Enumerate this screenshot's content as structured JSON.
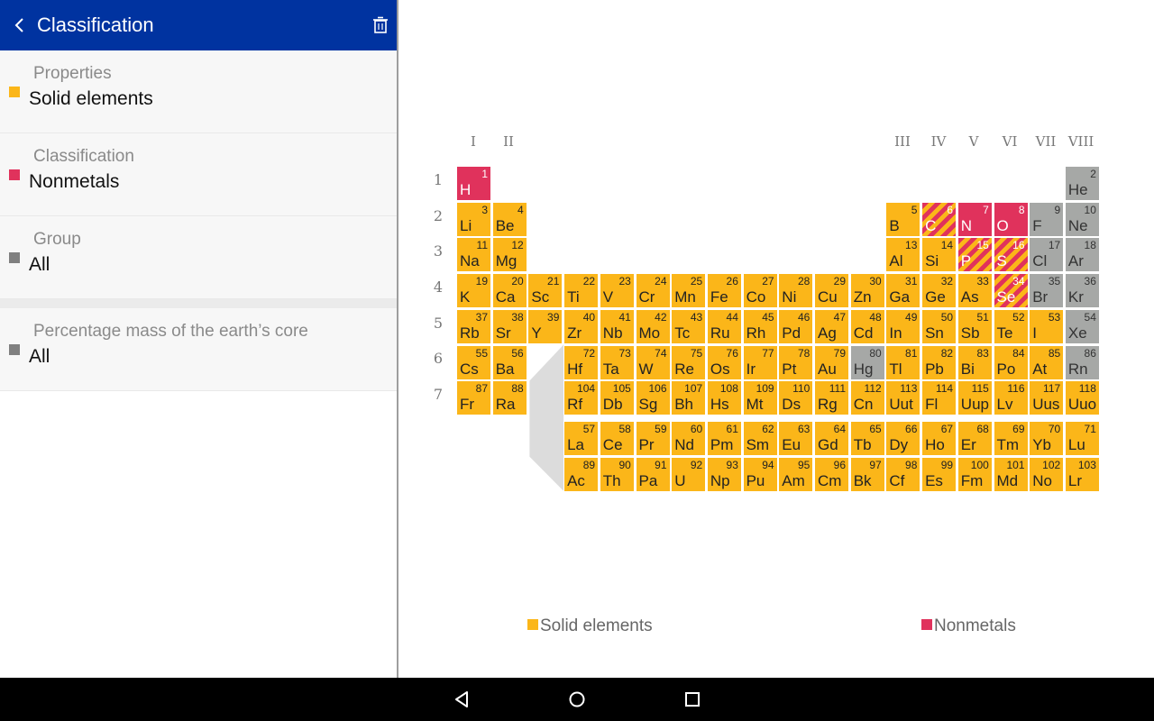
{
  "header": {
    "title": "Classification"
  },
  "filters": [
    {
      "label": "Properties",
      "value": "Solid elements",
      "color": "#fbb619"
    },
    {
      "label": "Classification",
      "value": "Nonmetals",
      "color": "#e0325c"
    },
    {
      "label": "Group",
      "value": "All",
      "color": "#808080"
    },
    {
      "label": "Percentage mass of the earth’s core",
      "value": "All",
      "color": "#808080"
    }
  ],
  "groups": [
    "I",
    "II",
    "III",
    "IV",
    "V",
    "VI",
    "VII",
    "VIII"
  ],
  "periods": [
    "1",
    "2",
    "3",
    "4",
    "5",
    "6",
    "7"
  ],
  "colors": {
    "solid": "#fbb619",
    "nonmetal": "#e0325c",
    "other": "#a6a8a6",
    "connector": "#dcdcdc"
  },
  "elements": [
    {
      "n": 1,
      "s": "H",
      "r": 1,
      "c": 1,
      "k": "nonmetal"
    },
    {
      "n": 2,
      "s": "He",
      "r": 1,
      "c": 18,
      "k": "other"
    },
    {
      "n": 3,
      "s": "Li",
      "r": 2,
      "c": 1,
      "k": "solid"
    },
    {
      "n": 4,
      "s": "Be",
      "r": 2,
      "c": 2,
      "k": "solid"
    },
    {
      "n": 5,
      "s": "B",
      "r": 2,
      "c": 13,
      "k": "solid"
    },
    {
      "n": 6,
      "s": "C",
      "r": 2,
      "c": 14,
      "k": "both"
    },
    {
      "n": 7,
      "s": "N",
      "r": 2,
      "c": 15,
      "k": "nonmetal"
    },
    {
      "n": 8,
      "s": "O",
      "r": 2,
      "c": 16,
      "k": "nonmetal"
    },
    {
      "n": 9,
      "s": "F",
      "r": 2,
      "c": 17,
      "k": "other"
    },
    {
      "n": 10,
      "s": "Ne",
      "r": 2,
      "c": 18,
      "k": "other"
    },
    {
      "n": 11,
      "s": "Na",
      "r": 3,
      "c": 1,
      "k": "solid"
    },
    {
      "n": 12,
      "s": "Mg",
      "r": 3,
      "c": 2,
      "k": "solid"
    },
    {
      "n": 13,
      "s": "Al",
      "r": 3,
      "c": 13,
      "k": "solid"
    },
    {
      "n": 14,
      "s": "Si",
      "r": 3,
      "c": 14,
      "k": "solid"
    },
    {
      "n": 15,
      "s": "P",
      "r": 3,
      "c": 15,
      "k": "both"
    },
    {
      "n": 16,
      "s": "S",
      "r": 3,
      "c": 16,
      "k": "both"
    },
    {
      "n": 17,
      "s": "Cl",
      "r": 3,
      "c": 17,
      "k": "other"
    },
    {
      "n": 18,
      "s": "Ar",
      "r": 3,
      "c": 18,
      "k": "other"
    },
    {
      "n": 19,
      "s": "K",
      "r": 4,
      "c": 1,
      "k": "solid"
    },
    {
      "n": 20,
      "s": "Ca",
      "r": 4,
      "c": 2,
      "k": "solid"
    },
    {
      "n": 21,
      "s": "Sc",
      "r": 4,
      "c": 3,
      "k": "solid"
    },
    {
      "n": 22,
      "s": "Ti",
      "r": 4,
      "c": 4,
      "k": "solid"
    },
    {
      "n": 23,
      "s": "V",
      "r": 4,
      "c": 5,
      "k": "solid"
    },
    {
      "n": 24,
      "s": "Cr",
      "r": 4,
      "c": 6,
      "k": "solid"
    },
    {
      "n": 25,
      "s": "Mn",
      "r": 4,
      "c": 7,
      "k": "solid"
    },
    {
      "n": 26,
      "s": "Fe",
      "r": 4,
      "c": 8,
      "k": "solid"
    },
    {
      "n": 27,
      "s": "Co",
      "r": 4,
      "c": 9,
      "k": "solid"
    },
    {
      "n": 28,
      "s": "Ni",
      "r": 4,
      "c": 10,
      "k": "solid"
    },
    {
      "n": 29,
      "s": "Cu",
      "r": 4,
      "c": 11,
      "k": "solid"
    },
    {
      "n": 30,
      "s": "Zn",
      "r": 4,
      "c": 12,
      "k": "solid"
    },
    {
      "n": 31,
      "s": "Ga",
      "r": 4,
      "c": 13,
      "k": "solid"
    },
    {
      "n": 32,
      "s": "Ge",
      "r": 4,
      "c": 14,
      "k": "solid"
    },
    {
      "n": 33,
      "s": "As",
      "r": 4,
      "c": 15,
      "k": "solid"
    },
    {
      "n": 34,
      "s": "Se",
      "r": 4,
      "c": 16,
      "k": "both"
    },
    {
      "n": 35,
      "s": "Br",
      "r": 4,
      "c": 17,
      "k": "other"
    },
    {
      "n": 36,
      "s": "Kr",
      "r": 4,
      "c": 18,
      "k": "other"
    },
    {
      "n": 37,
      "s": "Rb",
      "r": 5,
      "c": 1,
      "k": "solid"
    },
    {
      "n": 38,
      "s": "Sr",
      "r": 5,
      "c": 2,
      "k": "solid"
    },
    {
      "n": 39,
      "s": "Y",
      "r": 5,
      "c": 3,
      "k": "solid"
    },
    {
      "n": 40,
      "s": "Zr",
      "r": 5,
      "c": 4,
      "k": "solid"
    },
    {
      "n": 41,
      "s": "Nb",
      "r": 5,
      "c": 5,
      "k": "solid"
    },
    {
      "n": 42,
      "s": "Mo",
      "r": 5,
      "c": 6,
      "k": "solid"
    },
    {
      "n": 43,
      "s": "Tc",
      "r": 5,
      "c": 7,
      "k": "solid"
    },
    {
      "n": 44,
      "s": "Ru",
      "r": 5,
      "c": 8,
      "k": "solid"
    },
    {
      "n": 45,
      "s": "Rh",
      "r": 5,
      "c": 9,
      "k": "solid"
    },
    {
      "n": 46,
      "s": "Pd",
      "r": 5,
      "c": 10,
      "k": "solid"
    },
    {
      "n": 47,
      "s": "Ag",
      "r": 5,
      "c": 11,
      "k": "solid"
    },
    {
      "n": 48,
      "s": "Cd",
      "r": 5,
      "c": 12,
      "k": "solid"
    },
    {
      "n": 49,
      "s": "In",
      "r": 5,
      "c": 13,
      "k": "solid"
    },
    {
      "n": 50,
      "s": "Sn",
      "r": 5,
      "c": 14,
      "k": "solid"
    },
    {
      "n": 51,
      "s": "Sb",
      "r": 5,
      "c": 15,
      "k": "solid"
    },
    {
      "n": 52,
      "s": "Te",
      "r": 5,
      "c": 16,
      "k": "solid"
    },
    {
      "n": 53,
      "s": "I",
      "r": 5,
      "c": 17,
      "k": "solid"
    },
    {
      "n": 54,
      "s": "Xe",
      "r": 5,
      "c": 18,
      "k": "other"
    },
    {
      "n": 55,
      "s": "Cs",
      "r": 6,
      "c": 1,
      "k": "solid"
    },
    {
      "n": 56,
      "s": "Ba",
      "r": 6,
      "c": 2,
      "k": "solid"
    },
    {
      "n": 72,
      "s": "Hf",
      "r": 6,
      "c": 4,
      "k": "solid"
    },
    {
      "n": 73,
      "s": "Ta",
      "r": 6,
      "c": 5,
      "k": "solid"
    },
    {
      "n": 74,
      "s": "W",
      "r": 6,
      "c": 6,
      "k": "solid"
    },
    {
      "n": 75,
      "s": "Re",
      "r": 6,
      "c": 7,
      "k": "solid"
    },
    {
      "n": 76,
      "s": "Os",
      "r": 6,
      "c": 8,
      "k": "solid"
    },
    {
      "n": 77,
      "s": "Ir",
      "r": 6,
      "c": 9,
      "k": "solid"
    },
    {
      "n": 78,
      "s": "Pt",
      "r": 6,
      "c": 10,
      "k": "solid"
    },
    {
      "n": 79,
      "s": "Au",
      "r": 6,
      "c": 11,
      "k": "solid"
    },
    {
      "n": 80,
      "s": "Hg",
      "r": 6,
      "c": 12,
      "k": "other"
    },
    {
      "n": 81,
      "s": "Tl",
      "r": 6,
      "c": 13,
      "k": "solid"
    },
    {
      "n": 82,
      "s": "Pb",
      "r": 6,
      "c": 14,
      "k": "solid"
    },
    {
      "n": 83,
      "s": "Bi",
      "r": 6,
      "c": 15,
      "k": "solid"
    },
    {
      "n": 84,
      "s": "Po",
      "r": 6,
      "c": 16,
      "k": "solid"
    },
    {
      "n": 85,
      "s": "At",
      "r": 6,
      "c": 17,
      "k": "solid"
    },
    {
      "n": 86,
      "s": "Rn",
      "r": 6,
      "c": 18,
      "k": "other"
    },
    {
      "n": 87,
      "s": "Fr",
      "r": 7,
      "c": 1,
      "k": "solid"
    },
    {
      "n": 88,
      "s": "Ra",
      "r": 7,
      "c": 2,
      "k": "solid"
    },
    {
      "n": 104,
      "s": "Rf",
      "r": 7,
      "c": 4,
      "k": "solid"
    },
    {
      "n": 105,
      "s": "Db",
      "r": 7,
      "c": 5,
      "k": "solid"
    },
    {
      "n": 106,
      "s": "Sg",
      "r": 7,
      "c": 6,
      "k": "solid"
    },
    {
      "n": 107,
      "s": "Bh",
      "r": 7,
      "c": 7,
      "k": "solid"
    },
    {
      "n": 108,
      "s": "Hs",
      "r": 7,
      "c": 8,
      "k": "solid"
    },
    {
      "n": 109,
      "s": "Mt",
      "r": 7,
      "c": 9,
      "k": "solid"
    },
    {
      "n": 110,
      "s": "Ds",
      "r": 7,
      "c": 10,
      "k": "solid"
    },
    {
      "n": 111,
      "s": "Rg",
      "r": 7,
      "c": 11,
      "k": "solid"
    },
    {
      "n": 112,
      "s": "Cn",
      "r": 7,
      "c": 12,
      "k": "solid"
    },
    {
      "n": 113,
      "s": "Uut",
      "r": 7,
      "c": 13,
      "k": "solid"
    },
    {
      "n": 114,
      "s": "Fl",
      "r": 7,
      "c": 14,
      "k": "solid"
    },
    {
      "n": 115,
      "s": "Uup",
      "r": 7,
      "c": 15,
      "k": "solid"
    },
    {
      "n": 116,
      "s": "Lv",
      "r": 7,
      "c": 16,
      "k": "solid"
    },
    {
      "n": 117,
      "s": "Uus",
      "r": 7,
      "c": 17,
      "k": "solid"
    },
    {
      "n": 118,
      "s": "Uuo",
      "r": 7,
      "c": 18,
      "k": "solid"
    },
    {
      "n": 57,
      "s": "La",
      "r": 8,
      "c": 4,
      "k": "solid"
    },
    {
      "n": 58,
      "s": "Ce",
      "r": 8,
      "c": 5,
      "k": "solid"
    },
    {
      "n": 59,
      "s": "Pr",
      "r": 8,
      "c": 6,
      "k": "solid"
    },
    {
      "n": 60,
      "s": "Nd",
      "r": 8,
      "c": 7,
      "k": "solid"
    },
    {
      "n": 61,
      "s": "Pm",
      "r": 8,
      "c": 8,
      "k": "solid"
    },
    {
      "n": 62,
      "s": "Sm",
      "r": 8,
      "c": 9,
      "k": "solid"
    },
    {
      "n": 63,
      "s": "Eu",
      "r": 8,
      "c": 10,
      "k": "solid"
    },
    {
      "n": 64,
      "s": "Gd",
      "r": 8,
      "c": 11,
      "k": "solid"
    },
    {
      "n": 65,
      "s": "Tb",
      "r": 8,
      "c": 12,
      "k": "solid"
    },
    {
      "n": 66,
      "s": "Dy",
      "r": 8,
      "c": 13,
      "k": "solid"
    },
    {
      "n": 67,
      "s": "Ho",
      "r": 8,
      "c": 14,
      "k": "solid"
    },
    {
      "n": 68,
      "s": "Er",
      "r": 8,
      "c": 15,
      "k": "solid"
    },
    {
      "n": 69,
      "s": "Tm",
      "r": 8,
      "c": 16,
      "k": "solid"
    },
    {
      "n": 70,
      "s": "Yb",
      "r": 8,
      "c": 17,
      "k": "solid"
    },
    {
      "n": 71,
      "s": "Lu",
      "r": 8,
      "c": 18,
      "k": "solid"
    },
    {
      "n": 89,
      "s": "Ac",
      "r": 9,
      "c": 4,
      "k": "solid"
    },
    {
      "n": 90,
      "s": "Th",
      "r": 9,
      "c": 5,
      "k": "solid"
    },
    {
      "n": 91,
      "s": "Pa",
      "r": 9,
      "c": 6,
      "k": "solid"
    },
    {
      "n": 92,
      "s": "U",
      "r": 9,
      "c": 7,
      "k": "solid"
    },
    {
      "n": 93,
      "s": "Np",
      "r": 9,
      "c": 8,
      "k": "solid"
    },
    {
      "n": 94,
      "s": "Pu",
      "r": 9,
      "c": 9,
      "k": "solid"
    },
    {
      "n": 95,
      "s": "Am",
      "r": 9,
      "c": 10,
      "k": "solid"
    },
    {
      "n": 96,
      "s": "Cm",
      "r": 9,
      "c": 11,
      "k": "solid"
    },
    {
      "n": 97,
      "s": "Bk",
      "r": 9,
      "c": 12,
      "k": "solid"
    },
    {
      "n": 98,
      "s": "Cf",
      "r": 9,
      "c": 13,
      "k": "solid"
    },
    {
      "n": 99,
      "s": "Es",
      "r": 9,
      "c": 14,
      "k": "solid"
    },
    {
      "n": 100,
      "s": "Fm",
      "r": 9,
      "c": 15,
      "k": "solid"
    },
    {
      "n": 101,
      "s": "Md",
      "r": 9,
      "c": 16,
      "k": "solid"
    },
    {
      "n": 102,
      "s": "No",
      "r": 9,
      "c": 17,
      "k": "solid"
    },
    {
      "n": 103,
      "s": "Lr",
      "r": 9,
      "c": 18,
      "k": "solid"
    }
  ],
  "legend": [
    {
      "label": "Solid elements",
      "color": "#fbb619"
    },
    {
      "label": "Nonmetals",
      "color": "#e0325c"
    }
  ],
  "nav": {
    "icons": [
      "back-icon",
      "home-icon",
      "recents-icon"
    ]
  }
}
